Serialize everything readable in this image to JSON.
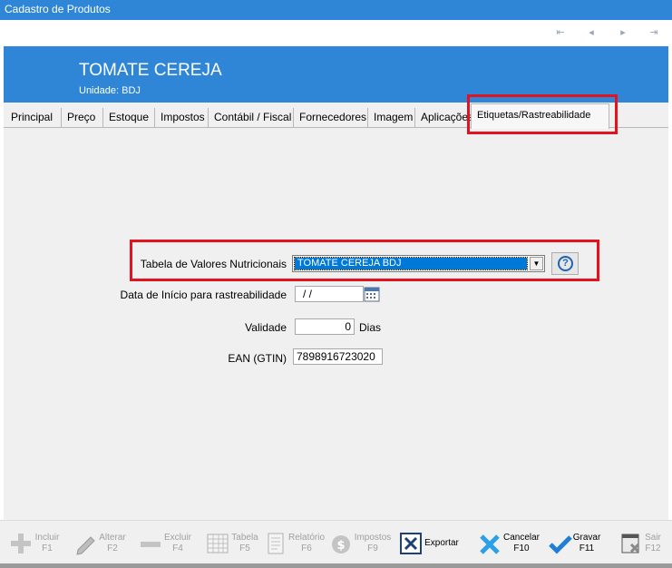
{
  "window": {
    "title": "Cadastro de Produtos"
  },
  "nav": {
    "first": "⇤",
    "prev": "◂",
    "next": "▸",
    "last": "⇥"
  },
  "header": {
    "product_name": "TOMATE CEREJA",
    "unit_label": "Unidade:",
    "unit_value": "BDJ"
  },
  "tabs": [
    {
      "label": "Principal"
    },
    {
      "label": "Preço"
    },
    {
      "label": "Estoque"
    },
    {
      "label": "Impostos"
    },
    {
      "label": "Contábil / Fiscal"
    },
    {
      "label": "Fornecedores"
    },
    {
      "label": "Imagem"
    },
    {
      "label": "Aplicações"
    },
    {
      "label": "Etiquetas/Rastreabilidade"
    }
  ],
  "form": {
    "nutrition_label": "Tabela de Valores Nutricionais",
    "nutrition_value": "TOMATE CEREJA BDJ",
    "start_date_label": "Data de Início para rastreabilidade",
    "start_date_value": "/ /",
    "validity_label": "Validade",
    "validity_value": "0",
    "validity_unit": "Dias",
    "ean_label": "EAN (GTIN)",
    "ean_value": "7898916723020",
    "help_symbol": "?"
  },
  "toolbar": {
    "incluir": {
      "label": "Incluir",
      "key": "F1"
    },
    "alterar": {
      "label": "Alterar",
      "key": "F2"
    },
    "excluir": {
      "label": "Excluir",
      "key": "F4"
    },
    "tabela": {
      "label": "Tabela",
      "key": "F5"
    },
    "relatorio": {
      "label": "Relatório",
      "key": "F6"
    },
    "impostos": {
      "label": "Impostos",
      "key": "F9"
    },
    "exportar": {
      "label": "Exportar"
    },
    "cancelar": {
      "label": "Cancelar",
      "key": "F10"
    },
    "gravar": {
      "label": "Gravar",
      "key": "F11"
    },
    "sair": {
      "label": "Sair",
      "key": "F12"
    }
  },
  "colors": {
    "accent": "#2f86d7",
    "highlight": "#e3121f",
    "selection": "#0078d7"
  }
}
